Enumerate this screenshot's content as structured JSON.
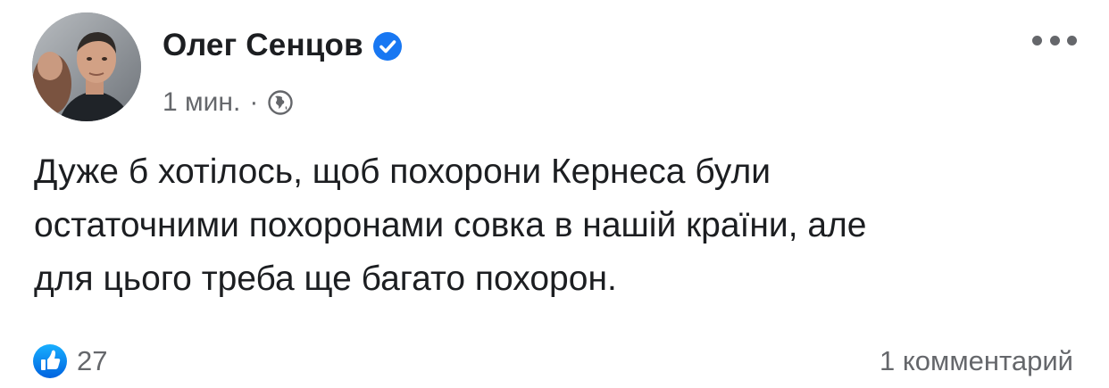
{
  "post": {
    "author": "Олег Сенцов",
    "verified_icon": "verified-badge-icon",
    "time": "1 мин.",
    "separator": "·",
    "audience_icon": "globe-icon",
    "text": "Дуже б хотілось, щоб похорони Кернеса були\nостаточними похоронами совка в нашій країни, але\nдля цього треба ще багато похорон.",
    "reactions": {
      "icon": "like-icon",
      "count": "27"
    },
    "comments": "1 комментарий",
    "more_icon": "more-options-icon"
  },
  "colors": {
    "accent": "#1877f2",
    "text": "#1c1e21",
    "secondary_text": "#65676b"
  }
}
